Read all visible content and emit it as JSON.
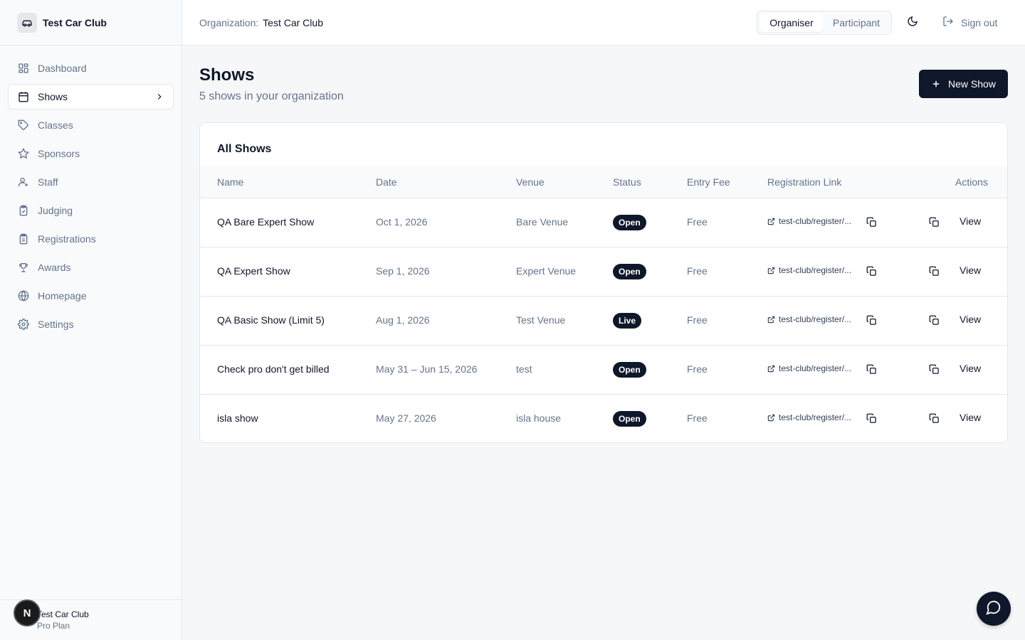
{
  "brand": {
    "name": "Test Car Club",
    "icon": "car-icon"
  },
  "sidebar": {
    "items": [
      {
        "label": "Dashboard",
        "icon": "dashboard-icon"
      },
      {
        "label": "Shows",
        "icon": "calendar-icon",
        "active": true
      },
      {
        "label": "Classes",
        "icon": "tag-icon"
      },
      {
        "label": "Sponsors",
        "icon": "star-icon"
      },
      {
        "label": "Staff",
        "icon": "user-icon"
      },
      {
        "label": "Judging",
        "icon": "clipboard-check-icon"
      },
      {
        "label": "Registrations",
        "icon": "clipboard-icon"
      },
      {
        "label": "Awards",
        "icon": "trophy-icon"
      },
      {
        "label": "Homepage",
        "icon": "globe-icon"
      },
      {
        "label": "Settings",
        "icon": "gear-icon"
      }
    ],
    "footer": {
      "club": "Test Car Club",
      "plan": "Pro Plan",
      "avatar_letter": "N"
    }
  },
  "topbar": {
    "org_label": "Organization:",
    "org_name": "Test Car Club",
    "roles": [
      "Organiser",
      "Participant"
    ],
    "active_role": "Organiser",
    "signout_label": "Sign out"
  },
  "page": {
    "title": "Shows",
    "subtitle": "5 shows in your organization",
    "new_button": "New Show"
  },
  "table": {
    "title": "All Shows",
    "columns": [
      "Name",
      "Date",
      "Venue",
      "Status",
      "Entry Fee",
      "Registration Link",
      "Actions"
    ],
    "rows": [
      {
        "name": "QA Bare Expert Show",
        "date": "Oct 1, 2026",
        "venue": "Bare Venue",
        "status": "Open",
        "fee": "Free",
        "link": "test-club/register/...",
        "action": "View"
      },
      {
        "name": "QA Expert Show",
        "date": "Sep 1, 2026",
        "venue": "Expert Venue",
        "status": "Open",
        "fee": "Free",
        "link": "test-club/register/...",
        "action": "View"
      },
      {
        "name": "QA Basic Show (Limit 5)",
        "date": "Aug 1, 2026",
        "venue": "Test Venue",
        "status": "Live",
        "fee": "Free",
        "link": "test-club/register/...",
        "action": "View"
      },
      {
        "name": "Check pro don't get billed",
        "date": "May 31 – Jun 15, 2026",
        "venue": "test",
        "status": "Open",
        "fee": "Free",
        "link": "test-club/register/...",
        "action": "View"
      },
      {
        "name": "isla show",
        "date": "May 27, 2026",
        "venue": "isla house",
        "status": "Open",
        "fee": "Free",
        "link": "test-club/register/...",
        "action": "View"
      }
    ]
  },
  "colors": {
    "primary": "#0f172a",
    "muted": "#64748b",
    "border": "#e5e7eb",
    "background": "#f6f7f9"
  }
}
